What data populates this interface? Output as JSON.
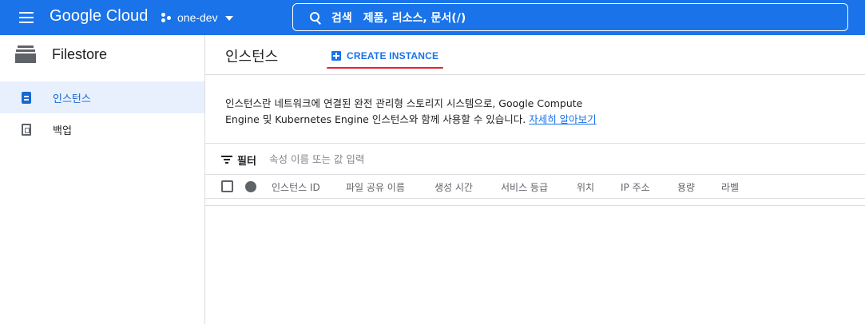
{
  "topbar": {
    "brand": "Google Cloud",
    "project": "one-dev",
    "search_label": "검색",
    "search_hint": "제품, 리소스, 문서(/)"
  },
  "sidebar": {
    "title": "Filestore",
    "items": [
      {
        "label": "인스턴스",
        "icon": "instance-icon",
        "active": true
      },
      {
        "label": "백업",
        "icon": "backup-icon",
        "active": false
      }
    ]
  },
  "main": {
    "title": "인스턴스",
    "create_label": "CREATE INSTANCE",
    "description_line1": "인스턴스란 네트워크에 연결된 완전 관리형 스토리지 시스템으로, Google Compute",
    "description_line2": "Engine 및 Kubernetes Engine 인스턴스와 함께 사용할 수 있습니다.",
    "learn_more": "자세히 알아보기",
    "filter_label": "필터",
    "filter_placeholder": "속성 이름 또는 값 입력",
    "columns": [
      "인스턴스 ID",
      "파일 공유 이름",
      "생성 시간",
      "서비스 등급",
      "위치",
      "IP 주소",
      "용량",
      "라벨"
    ]
  },
  "colors": {
    "topbar": "#1a73e8",
    "accent": "#1a73e8",
    "active_bg": "#e8f0fe",
    "underline": "#e8222e"
  }
}
